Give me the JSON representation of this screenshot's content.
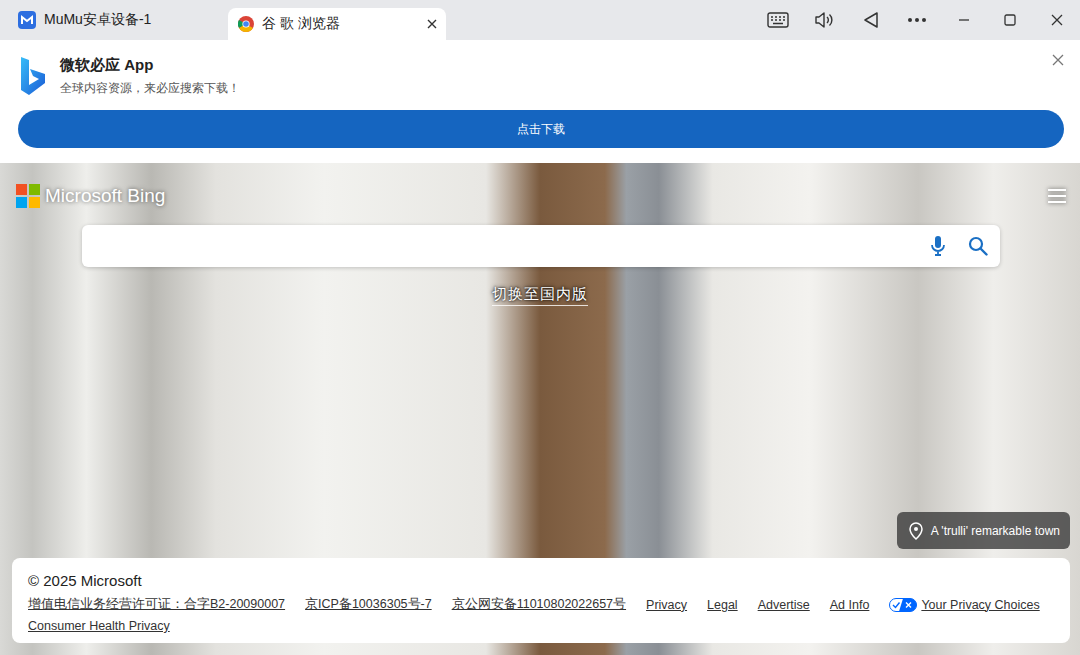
{
  "window": {
    "tabs": [
      {
        "label": "MuMu安卓设备-1",
        "selected": false
      },
      {
        "label": "谷 歌 浏览器",
        "selected": true
      }
    ]
  },
  "banner": {
    "title": "微软必应 App",
    "subtitle": "全球内容资源，来必应搜索下载！",
    "button": "点击下载"
  },
  "bing": {
    "logo": "Microsoft Bing",
    "switch_link": "切换至国内版",
    "location": "A 'trulli' remarkable town"
  },
  "footer": {
    "copyright": "© 2025 Microsoft",
    "links": [
      "增值电信业务经营许可证：合字B2-20090007",
      "京ICP备10036305号-7",
      "京公网安备11010802022657号",
      "Privacy",
      "Legal",
      "Advertise",
      "Ad Info",
      "Your Privacy Choices",
      "Consumer Health Privacy"
    ]
  }
}
